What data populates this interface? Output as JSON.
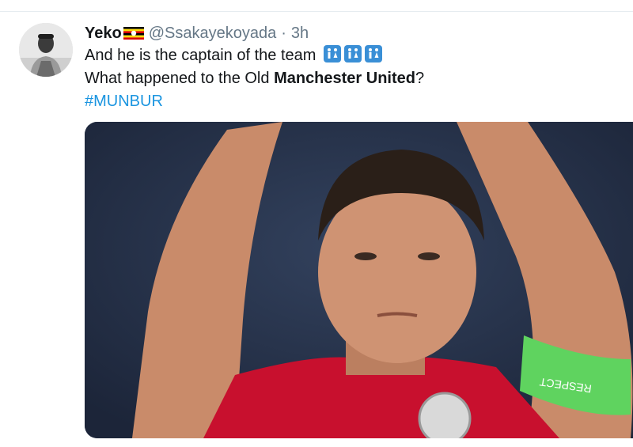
{
  "tweet": {
    "display_name": "Yeko",
    "handle": "@Ssakayekoyada",
    "separator": "·",
    "time": "3h",
    "line1": "And he is the captain of the team",
    "line2_prefix": "What happened to the Old ",
    "line2_bold": "Manchester United",
    "line2_suffix": "?",
    "hashtag": "#MUNBUR",
    "emoji": [
      "toilet-sign-icon",
      "toilet-sign-icon",
      "toilet-sign-icon"
    ],
    "flag": "uganda-flag-icon"
  },
  "media": {
    "armband_text": "RESPECT",
    "colors": {
      "background": "#243047",
      "shirt": "#c8102e",
      "armband": "#5fd35f"
    }
  },
  "colors": {
    "link": "#1b95e0",
    "secondary_text": "#657786",
    "emoji_bg": "#3a8fd6"
  }
}
